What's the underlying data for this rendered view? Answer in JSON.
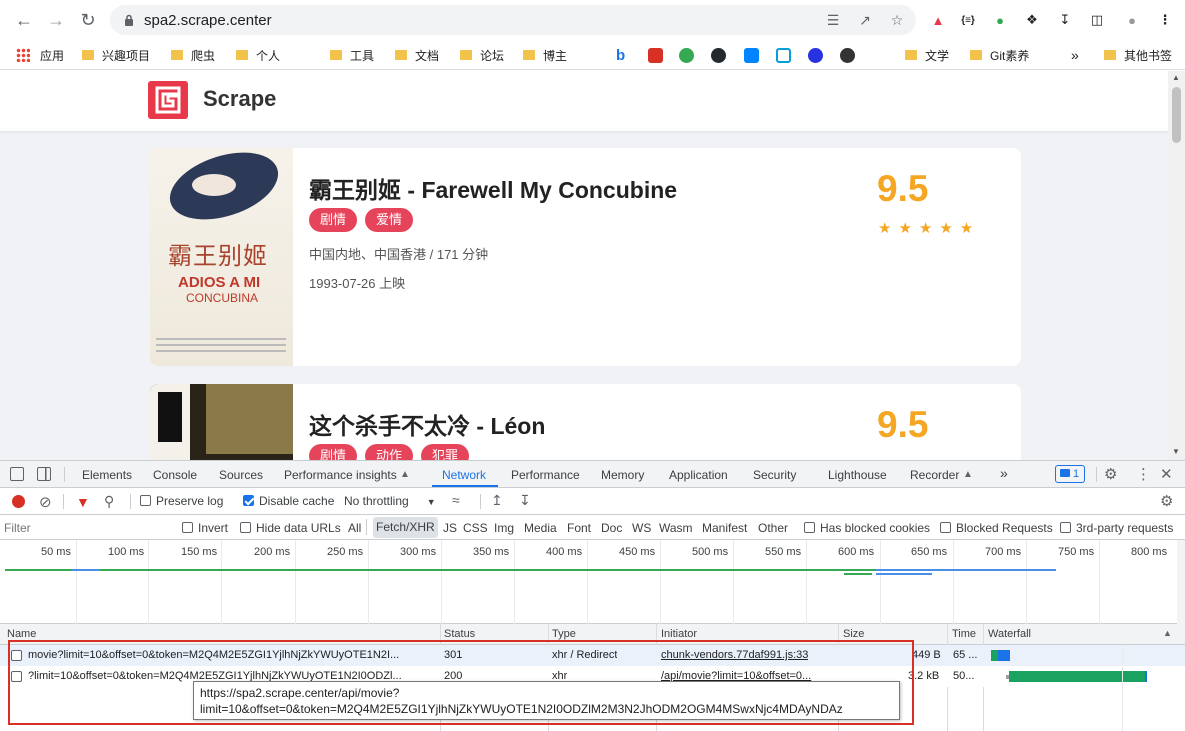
{
  "browser": {
    "url": "spa2.scrape.center",
    "bookmarks": [
      "应用",
      "兴趣项目",
      "爬虫",
      "个人",
      "工具",
      "文档",
      "论坛",
      "博主",
      "文学",
      "Git素养",
      "其他书签"
    ],
    "bookmark_more": "»"
  },
  "site": {
    "brand": "Scrape",
    "movies": [
      {
        "title": "霸王别姬 - Farewell My Concubine",
        "tags": [
          "剧情",
          "爱情"
        ],
        "region_duration": "中国内地、中国香港 / 171 分钟",
        "release": "1993-07-26 上映",
        "score": "9.5",
        "poster_text_cn": "霸王别姬",
        "poster_text_en1": "ADIOS A MI",
        "poster_text_en2": "CONCUBINA"
      },
      {
        "title": "这个杀手不太冷 - Léon",
        "tags": [
          "剧情",
          "动作",
          "犯罪"
        ],
        "score": "9.5"
      }
    ]
  },
  "devtools": {
    "tabs": [
      "Elements",
      "Console",
      "Sources",
      "Performance insights",
      "Network",
      "Performance",
      "Memory",
      "Application",
      "Security",
      "Lighthouse",
      "Recorder"
    ],
    "active_tab": "Network",
    "more": "»",
    "issues_count": "1",
    "preserve_log": "Preserve log",
    "disable_cache": "Disable cache",
    "throttling": "No throttling",
    "filter_placeholder": "Filter",
    "invert": "Invert",
    "hide_data_urls": "Hide data URLs",
    "type_filters": [
      "All",
      "Fetch/XHR",
      "JS",
      "CSS",
      "Img",
      "Media",
      "Font",
      "Doc",
      "WS",
      "Wasm",
      "Manifest",
      "Other"
    ],
    "has_blocked_cookies": "Has blocked cookies",
    "blocked_requests": "Blocked Requests",
    "third_party": "3rd-party requests",
    "ticks": [
      "50 ms",
      "100 ms",
      "150 ms",
      "200 ms",
      "250 ms",
      "300 ms",
      "350 ms",
      "400 ms",
      "450 ms",
      "500 ms",
      "550 ms",
      "600 ms",
      "650 ms",
      "700 ms",
      "750 ms",
      "800 ms"
    ],
    "columns": [
      "Name",
      "Status",
      "Type",
      "Initiator",
      "Size",
      "Time",
      "Waterfall"
    ],
    "rows": [
      {
        "name": "movie?limit=10&offset=0&token=M2Q4M2E5ZGI1YjlhNjZkYWUyOTE1N2I...",
        "status": "301",
        "type": "xhr / Redirect",
        "initiator": "chunk-vendors.77daf991.js:33",
        "size": "449 B",
        "time": "65 ..."
      },
      {
        "name": "?limit=10&offset=0&token=M2Q4M2E5ZGI1YjlhNjZkYWUyOTE1N2I0ODZl...",
        "status": "200",
        "type": "xhr",
        "initiator": "/api/movie?limit=10&offset=0...",
        "size": "3.2 kB",
        "time": "50..."
      }
    ],
    "tooltip_line1": "https://spa2.scrape.center/api/movie?",
    "tooltip_line2": "limit=10&offset=0&token=M2Q4M2E5ZGI1YjlhNjZkYWUyOTE1N2I0ODZlM2M3N2JhODM2OGM4MSwxNjc4MDAyNDAz"
  },
  "colors": {
    "brand_red": "#e8394a",
    "tag_red": "#e6445a",
    "score_gold": "#f5a623",
    "devtools_blue": "#1a73e8",
    "highlight_red": "#d93025"
  }
}
